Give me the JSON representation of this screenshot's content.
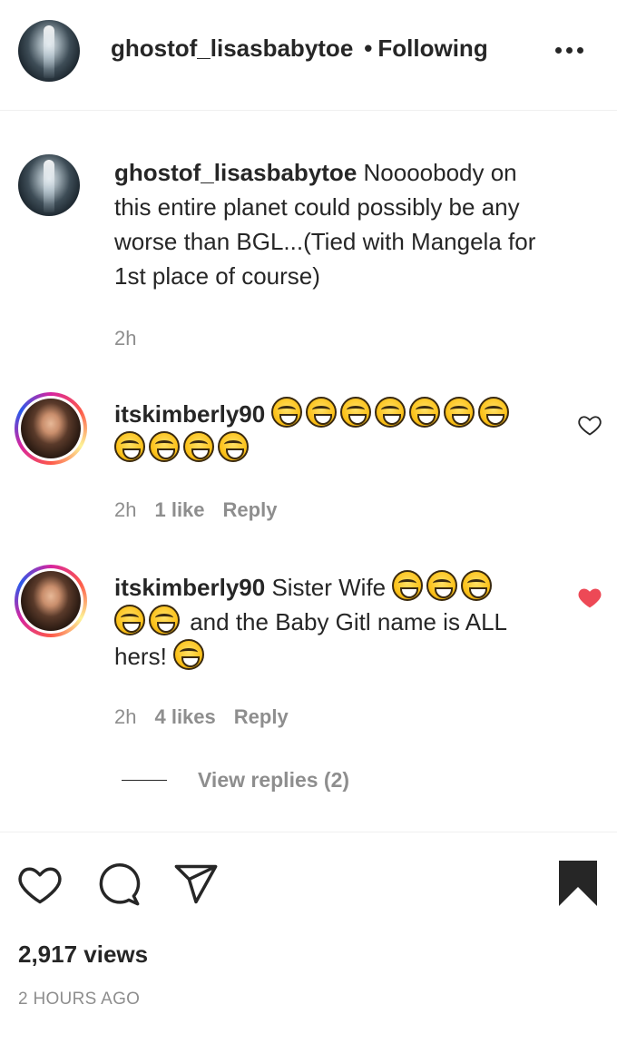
{
  "header": {
    "username": "ghostof_lisasbabytoe",
    "separator": "•",
    "follow_status": "Following",
    "more_icon": "more-horizontal-icon"
  },
  "caption": {
    "username": "ghostof_lisasbabytoe",
    "text_line1": " Noooobody on",
    "text_line2": "this entire planet could possibly be any",
    "text_line3": "worse than BGL...(Tied with Mangela for",
    "text_line4": "1st place of course)",
    "time": "2h"
  },
  "comments": [
    {
      "username": "itskimberly90",
      "emoji_count_line1": 7,
      "emoji_count_line2": 4,
      "emoji_name": "face-with-tears-of-joy",
      "time": "2h",
      "likes": "1 like",
      "reply": "Reply",
      "liked": false
    },
    {
      "username": "itskimberly90",
      "text_part1": " Sister Wife ",
      "text_part2": " and the Baby Gitl name is ALL",
      "text_part3": "hers! ",
      "emoji_name": "face-with-tears-of-joy",
      "time": "2h",
      "likes": "4 likes",
      "reply": "Reply",
      "liked": true
    }
  ],
  "view_replies": "View replies (2)",
  "actions": {
    "like_icon": "heart-outline-icon",
    "comment_icon": "comment-bubble-icon",
    "share_icon": "paper-plane-icon",
    "save_icon": "bookmark-filled-icon"
  },
  "views": "2,917 views",
  "timestamp": "2 HOURS AGO",
  "colors": {
    "text": "#262626",
    "muted": "#8e8e8e",
    "liked_heart": "#ed4956",
    "border": "#efefef"
  }
}
